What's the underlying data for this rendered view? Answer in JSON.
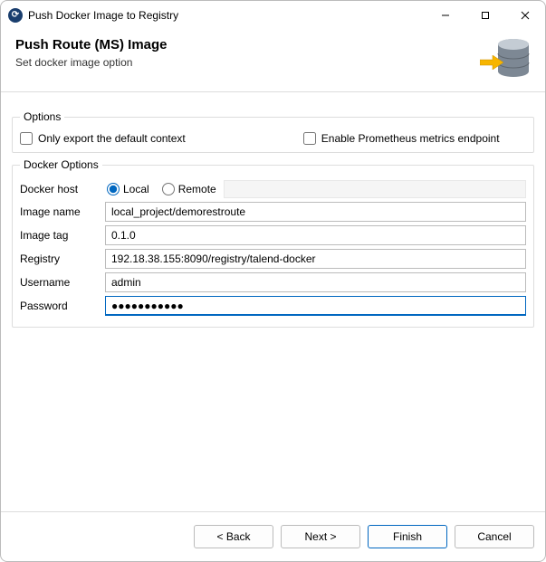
{
  "window": {
    "title": "Push Docker Image to Registry"
  },
  "header": {
    "title": "Push Route (MS) Image",
    "subtitle": "Set docker image option"
  },
  "options_group": {
    "legend": "Options",
    "only_export_label": "Only export the default context",
    "only_export_checked": false,
    "prometheus_label": "Enable Prometheus metrics endpoint",
    "prometheus_checked": false
  },
  "docker_group": {
    "legend": "Docker Options",
    "host_label": "Docker host",
    "host_local_label": "Local",
    "host_remote_label": "Remote",
    "host_selected": "local",
    "image_name_label": "Image name",
    "image_name_value": "local_project/demorestroute",
    "image_tag_label": "Image tag",
    "image_tag_value": "0.1.0",
    "registry_label": "Registry",
    "registry_value": "192.18.38.155:8090/registry/talend-docker",
    "username_label": "Username",
    "username_value": "admin",
    "password_label": "Password",
    "password_value": "●●●●●●●●●●●"
  },
  "footer": {
    "back_label": "< Back",
    "next_label": "Next >",
    "finish_label": "Finish",
    "cancel_label": "Cancel"
  }
}
